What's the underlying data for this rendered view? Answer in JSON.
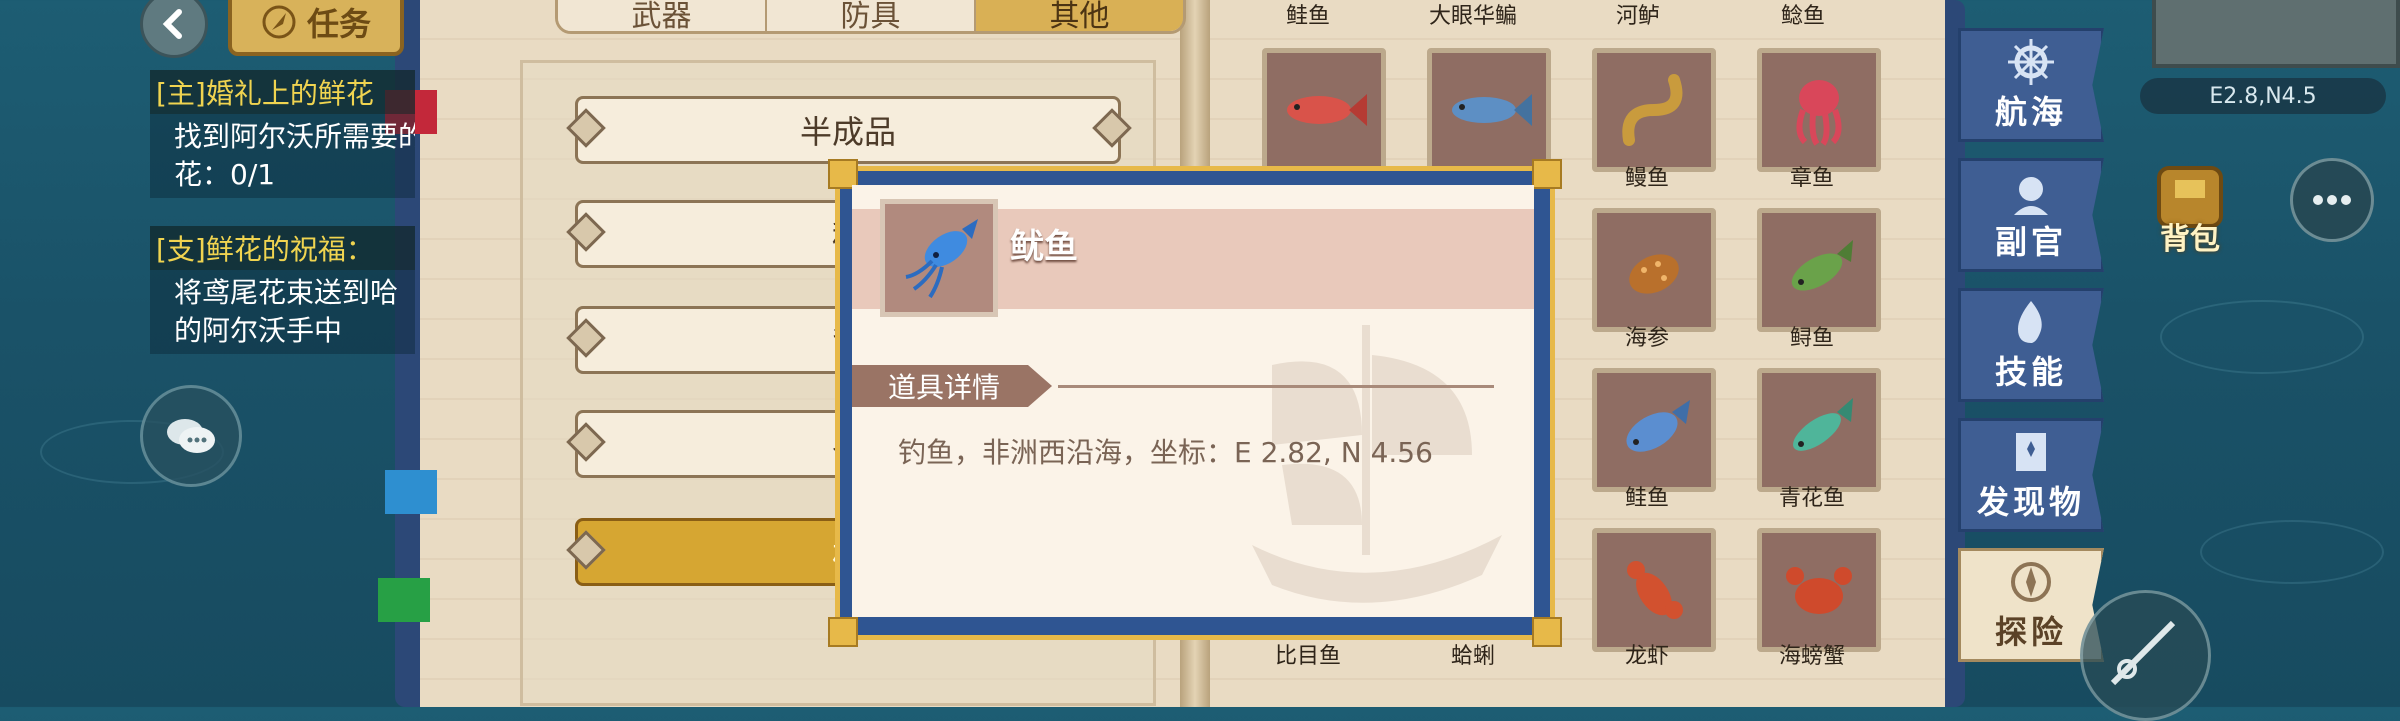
{
  "quest": {
    "back_icon": "chevron-left-icon",
    "tab_label": "任务",
    "items": [
      {
        "title": "[主]婚礼上的鲜花",
        "body": [
          "找到阿尔沃所需要的",
          "花：0/1"
        ]
      },
      {
        "title": "[支]鲜花的祝福：",
        "body": [
          "将鸢尾花束送到哈",
          "的阿尔沃手中"
        ]
      }
    ]
  },
  "categories": {
    "tabs": [
      "武器",
      "防具",
      "其他"
    ],
    "active": 2
  },
  "subnav": {
    "items": [
      "半成品",
      "种",
      "背",
      "农",
      "材"
    ],
    "active": 4
  },
  "fish_grid": {
    "top_labels": [
      "鲑鱼",
      "大眼华鳊",
      "河鲈",
      "鲶鱼"
    ],
    "rows": [
      [
        "",
        "",
        "鳗鱼",
        "章鱼"
      ],
      [
        "",
        "",
        "海参",
        "鲟鱼"
      ],
      [
        "",
        "",
        "鲑鱼",
        "青花鱼"
      ],
      [
        "比目鱼",
        "蛤蜊",
        "龙虾",
        "海螃蟹"
      ]
    ]
  },
  "side_nav": {
    "items": [
      "航海",
      "副官",
      "技能",
      "发现物",
      "探险"
    ],
    "active": 4
  },
  "hud": {
    "coords": "E2.8,N4.5",
    "bag_label": "背包",
    "more_icon": "more-icon"
  },
  "popup": {
    "name": "鱿鱼",
    "section": "道具详情",
    "description": "钓鱼，非洲西沿海，坐标：E 2.82, N 4.56"
  },
  "colors": {
    "book_cover": "#2c4877",
    "page": "#e9dbc3",
    "accent_gold": "#d6a632",
    "sea": "#1a5268"
  }
}
